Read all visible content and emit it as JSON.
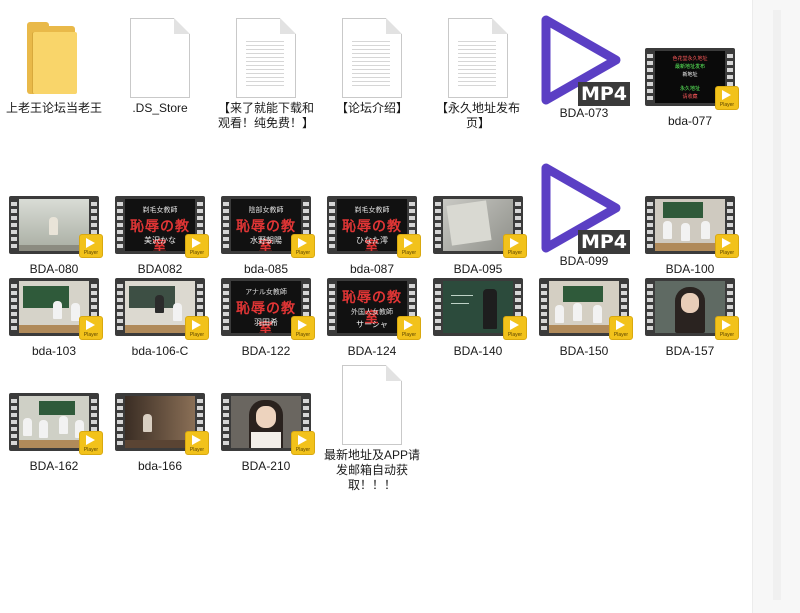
{
  "items": [
    {
      "label": "上老王论坛当老王",
      "icon": "folder-icon",
      "type": "folder"
    },
    {
      "label": ".DS_Store",
      "icon": "blank-file-icon",
      "type": "doc-blank"
    },
    {
      "label": "【来了就能下载和观看！纯免费！】",
      "icon": "text-file-icon",
      "type": "doc"
    },
    {
      "label": "【论坛介绍】",
      "icon": "text-file-icon",
      "type": "doc"
    },
    {
      "label": "【永久地址发布页】",
      "icon": "text-file-icon",
      "type": "doc"
    },
    {
      "label": "BDA-073",
      "icon": "mp4-file-icon",
      "type": "mp4",
      "badge": "MP4"
    },
    {
      "label": "bda-077",
      "icon": "video-thumbnail-icon",
      "type": "video",
      "scene": "green"
    },
    {
      "label": "BDA-080",
      "icon": "video-thumbnail-icon",
      "type": "video",
      "scene": "hallway"
    },
    {
      "label": "BDA082",
      "icon": "video-thumbnail-icon",
      "type": "video",
      "scene": "black",
      "title_small": "剃毛女教師",
      "title_big": "恥辱の教室",
      "title_sub": "美沢かな"
    },
    {
      "label": "bda-085",
      "icon": "video-thumbnail-icon",
      "type": "video",
      "scene": "black",
      "title_small": "陰部女教師",
      "title_big": "恥辱の教室",
      "title_sub": "水野朝陽"
    },
    {
      "label": "bda-087",
      "icon": "video-thumbnail-icon",
      "type": "video",
      "scene": "black",
      "title_small": "剃毛女教師",
      "title_big": "恥辱の教室",
      "title_sub": "ひなた澪"
    },
    {
      "label": "BDA-095",
      "icon": "video-thumbnail-icon",
      "type": "video",
      "scene": "gray"
    },
    {
      "label": "BDA-099",
      "icon": "mp4-file-icon",
      "type": "mp4",
      "badge": "MP4"
    },
    {
      "label": "BDA-100",
      "icon": "video-thumbnail-icon",
      "type": "video",
      "scene": "class"
    },
    {
      "label": "bda-103",
      "icon": "video-thumbnail-icon",
      "type": "video",
      "scene": "class"
    },
    {
      "label": "bda-106-C",
      "icon": "video-thumbnail-icon",
      "type": "video",
      "scene": "class"
    },
    {
      "label": "BDA-122",
      "icon": "video-thumbnail-icon",
      "type": "video",
      "scene": "black",
      "title_small": "アナル女教師",
      "title_big": "恥辱の教室",
      "title_sub": "羽田希"
    },
    {
      "label": "BDA-124",
      "icon": "video-thumbnail-icon",
      "type": "video",
      "scene": "black",
      "title_small": "",
      "title_big": "恥辱の教室",
      "title_sub": "サーシャ",
      "title_sub2": "外国人女教師"
    },
    {
      "label": "BDA-140",
      "icon": "video-thumbnail-icon",
      "type": "video",
      "scene": "board"
    },
    {
      "label": "BDA-150",
      "icon": "video-thumbnail-icon",
      "type": "video",
      "scene": "class"
    },
    {
      "label": "BDA-157",
      "icon": "video-thumbnail-icon",
      "type": "video",
      "scene": "portrait"
    },
    {
      "label": "BDA-162",
      "icon": "video-thumbnail-icon",
      "type": "video",
      "scene": "class"
    },
    {
      "label": "bda-166",
      "icon": "video-thumbnail-icon",
      "type": "video",
      "scene": "dark"
    },
    {
      "label": "BDA-210",
      "icon": "video-thumbnail-icon",
      "type": "video",
      "scene": "portrait"
    },
    {
      "label": "最新地址及APP请发邮箱自动获取！！！",
      "icon": "text-file-icon",
      "type": "doc-blank"
    }
  ],
  "player_badge": "Player",
  "green_text": [
    "色花堂永久地址",
    "最新地址发布",
    "新地址",
    "永久地址",
    "请收藏"
  ]
}
